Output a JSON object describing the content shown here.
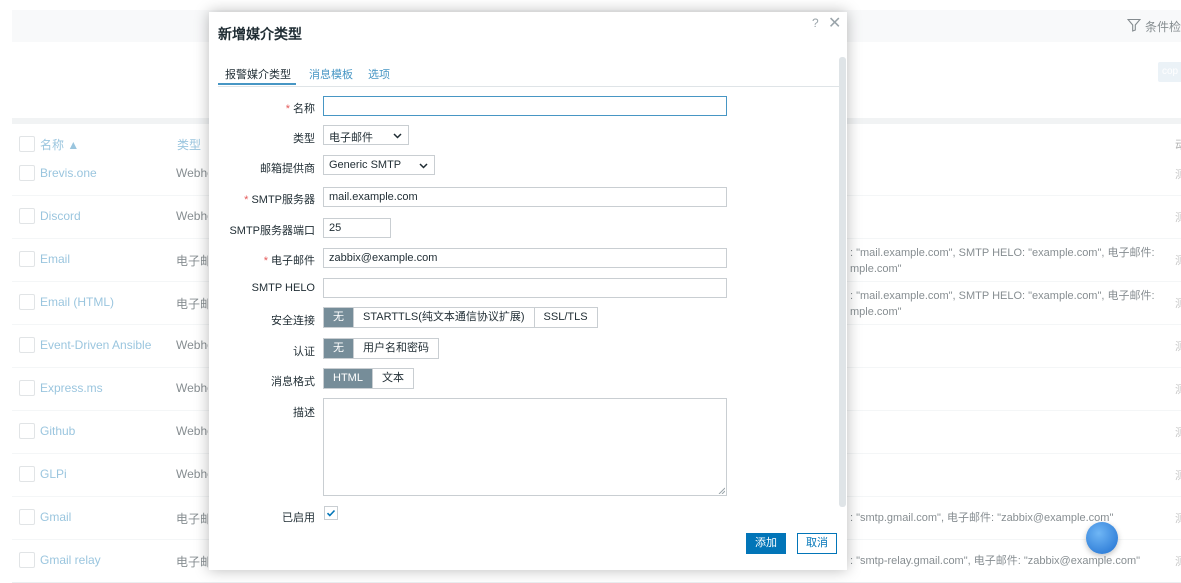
{
  "page": {
    "filter_label": "条件检",
    "corner_button": "cop",
    "columns": {
      "name": "名称 ▲",
      "type": "类型",
      "right": "动"
    },
    "rows": [
      {
        "name": "Brevis.one",
        "type": "Webhook",
        "details": "",
        "action": "测"
      },
      {
        "name": "Discord",
        "type": "Webhook",
        "details": "",
        "action": "测"
      },
      {
        "name": "Email",
        "type": "电子邮件",
        "details": ": \"mail.example.com\", SMTP HELO: \"example.com\", 电子邮件: mple.com\"",
        "action": "测"
      },
      {
        "name": "Email (HTML)",
        "type": "电子邮件",
        "details": ": \"mail.example.com\", SMTP HELO: \"example.com\", 电子邮件: mple.com\"",
        "action": "测"
      },
      {
        "name": "Event-Driven Ansible",
        "type": "Webhook",
        "details": "",
        "action": "测"
      },
      {
        "name": "Express.ms",
        "type": "Webhook",
        "details": "",
        "action": "测"
      },
      {
        "name": "Github",
        "type": "Webhook",
        "details": "",
        "action": "测"
      },
      {
        "name": "GLPi",
        "type": "Webhook",
        "details": "",
        "action": "测"
      },
      {
        "name": "Gmail",
        "type": "电子邮件",
        "details": ": \"smtp.gmail.com\", 电子邮件: \"zabbix@example.com\"",
        "action": "测"
      },
      {
        "name": "Gmail relay",
        "type": "电子邮件",
        "details": ": \"smtp-relay.gmail.com\", 电子邮件: \"zabbix@example.com\"",
        "action": "测"
      }
    ]
  },
  "modal": {
    "title": "新增媒介类型",
    "help": "?",
    "close": "✕",
    "tabs": [
      "报警媒介类型",
      "消息模板",
      "选项"
    ],
    "fields": {
      "name": {
        "label": "名称",
        "value": ""
      },
      "type": {
        "label": "类型",
        "value": "电子邮件"
      },
      "provider": {
        "label": "邮箱提供商",
        "value": "Generic SMTP"
      },
      "smtp_server": {
        "label": "SMTP服务器",
        "value": "mail.example.com"
      },
      "smtp_port": {
        "label": "SMTP服务器端口",
        "value": "25"
      },
      "email": {
        "label": "电子邮件",
        "value": "zabbix@example.com"
      },
      "smtp_helo": {
        "label": "SMTP HELO",
        "value": ""
      },
      "security": {
        "label": "安全连接",
        "options": [
          "无",
          "STARTTLS(纯文本通信协议扩展)",
          "SSL/TLS"
        ],
        "selected": "无"
      },
      "auth": {
        "label": "认证",
        "options": [
          "无",
          "用户名和密码"
        ],
        "selected": "无"
      },
      "format": {
        "label": "消息格式",
        "options": [
          "HTML",
          "文本"
        ],
        "selected": "HTML"
      },
      "description": {
        "label": "描述",
        "value": ""
      },
      "enabled": {
        "label": "已启用",
        "checked": true
      }
    },
    "buttons": {
      "add": "添加",
      "cancel": "取消"
    }
  },
  "colors": {
    "accent": "#0275b8",
    "link": "#4796c4",
    "segment_on": "#768d99",
    "required": "#e45959"
  }
}
